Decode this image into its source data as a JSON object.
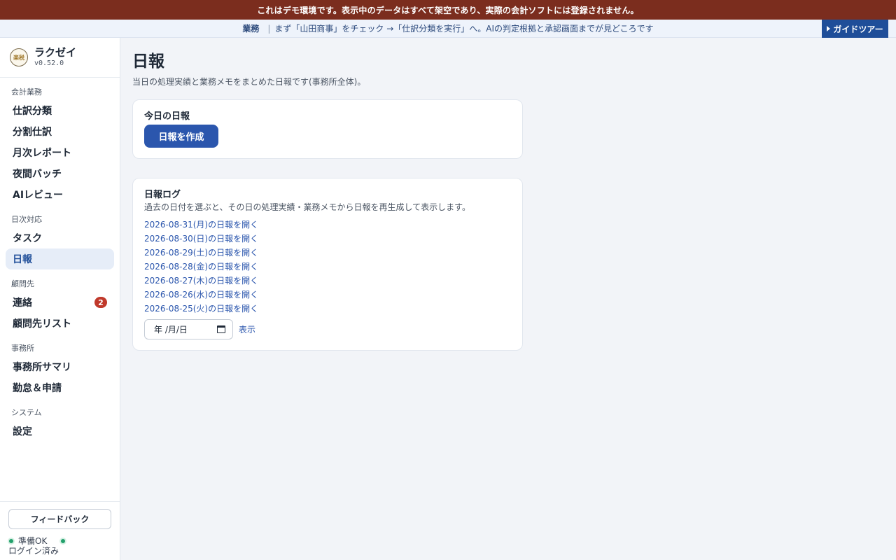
{
  "demo_banner": "これはデモ環境です。表示中のデータはすべて架空であり、実際の会計ソフトには登録されません。",
  "guide": {
    "tag": "業務",
    "separator": "|",
    "text": "まず「山田商事」をチェック →「仕訳分類を実行」へ。AIの判定根拠と承認画面までが見どころです",
    "button_label": "ガイドツアー"
  },
  "brand": {
    "logo_text": "楽税",
    "name": "ラクゼイ",
    "version": "v0.52.0"
  },
  "sidebar": {
    "sections": [
      {
        "label": "会計業務",
        "items": [
          {
            "label": "仕訳分類"
          },
          {
            "label": "分割仕訳"
          },
          {
            "label": "月次レポート"
          },
          {
            "label": "夜間バッチ"
          },
          {
            "label": "AIレビュー"
          }
        ]
      },
      {
        "label": "日次対応",
        "items": [
          {
            "label": "タスク"
          },
          {
            "label": "日報"
          }
        ]
      },
      {
        "label": "顧問先",
        "items": [
          {
            "label": "連絡",
            "badge": "2"
          },
          {
            "label": "顧問先リスト"
          }
        ]
      },
      {
        "label": "事務所",
        "items": [
          {
            "label": "事務所サマリ"
          },
          {
            "label": "勤怠＆申請"
          }
        ]
      },
      {
        "label": "システム",
        "items": [
          {
            "label": "設定"
          }
        ]
      }
    ],
    "active_item": "日報"
  },
  "footer": {
    "feedback_label": "フィードバック",
    "status_ready": "準備OK",
    "status_login": "ログイン済み",
    "status_color": "#22a06b"
  },
  "main": {
    "title": "日報",
    "description": "当日の処理実績と業務メモをまとめた日報です(事務所全体)。",
    "today_card": {
      "title": "今日の日報",
      "button_label": "日報を作成"
    },
    "log_card": {
      "title": "日報ログ",
      "subtitle": "過去の日付を選ぶと、その日の処理実績・業務メモから日報を再生成して表示します。",
      "links": [
        "2026-08-31(月)の日報を開く",
        "2026-08-30(日)の日報を開く",
        "2026-08-29(土)の日報を開く",
        "2026-08-28(金)の日報を開く",
        "2026-08-27(木)の日報を開く",
        "2026-08-26(水)の日報を開く",
        "2026-08-25(火)の日報を開く"
      ],
      "date_placeholder": "年 /月/日",
      "show_label": "表示"
    }
  },
  "colors": {
    "banner": "#7b2d1e",
    "accent": "#2b56ad",
    "badge": "#c0392b"
  }
}
